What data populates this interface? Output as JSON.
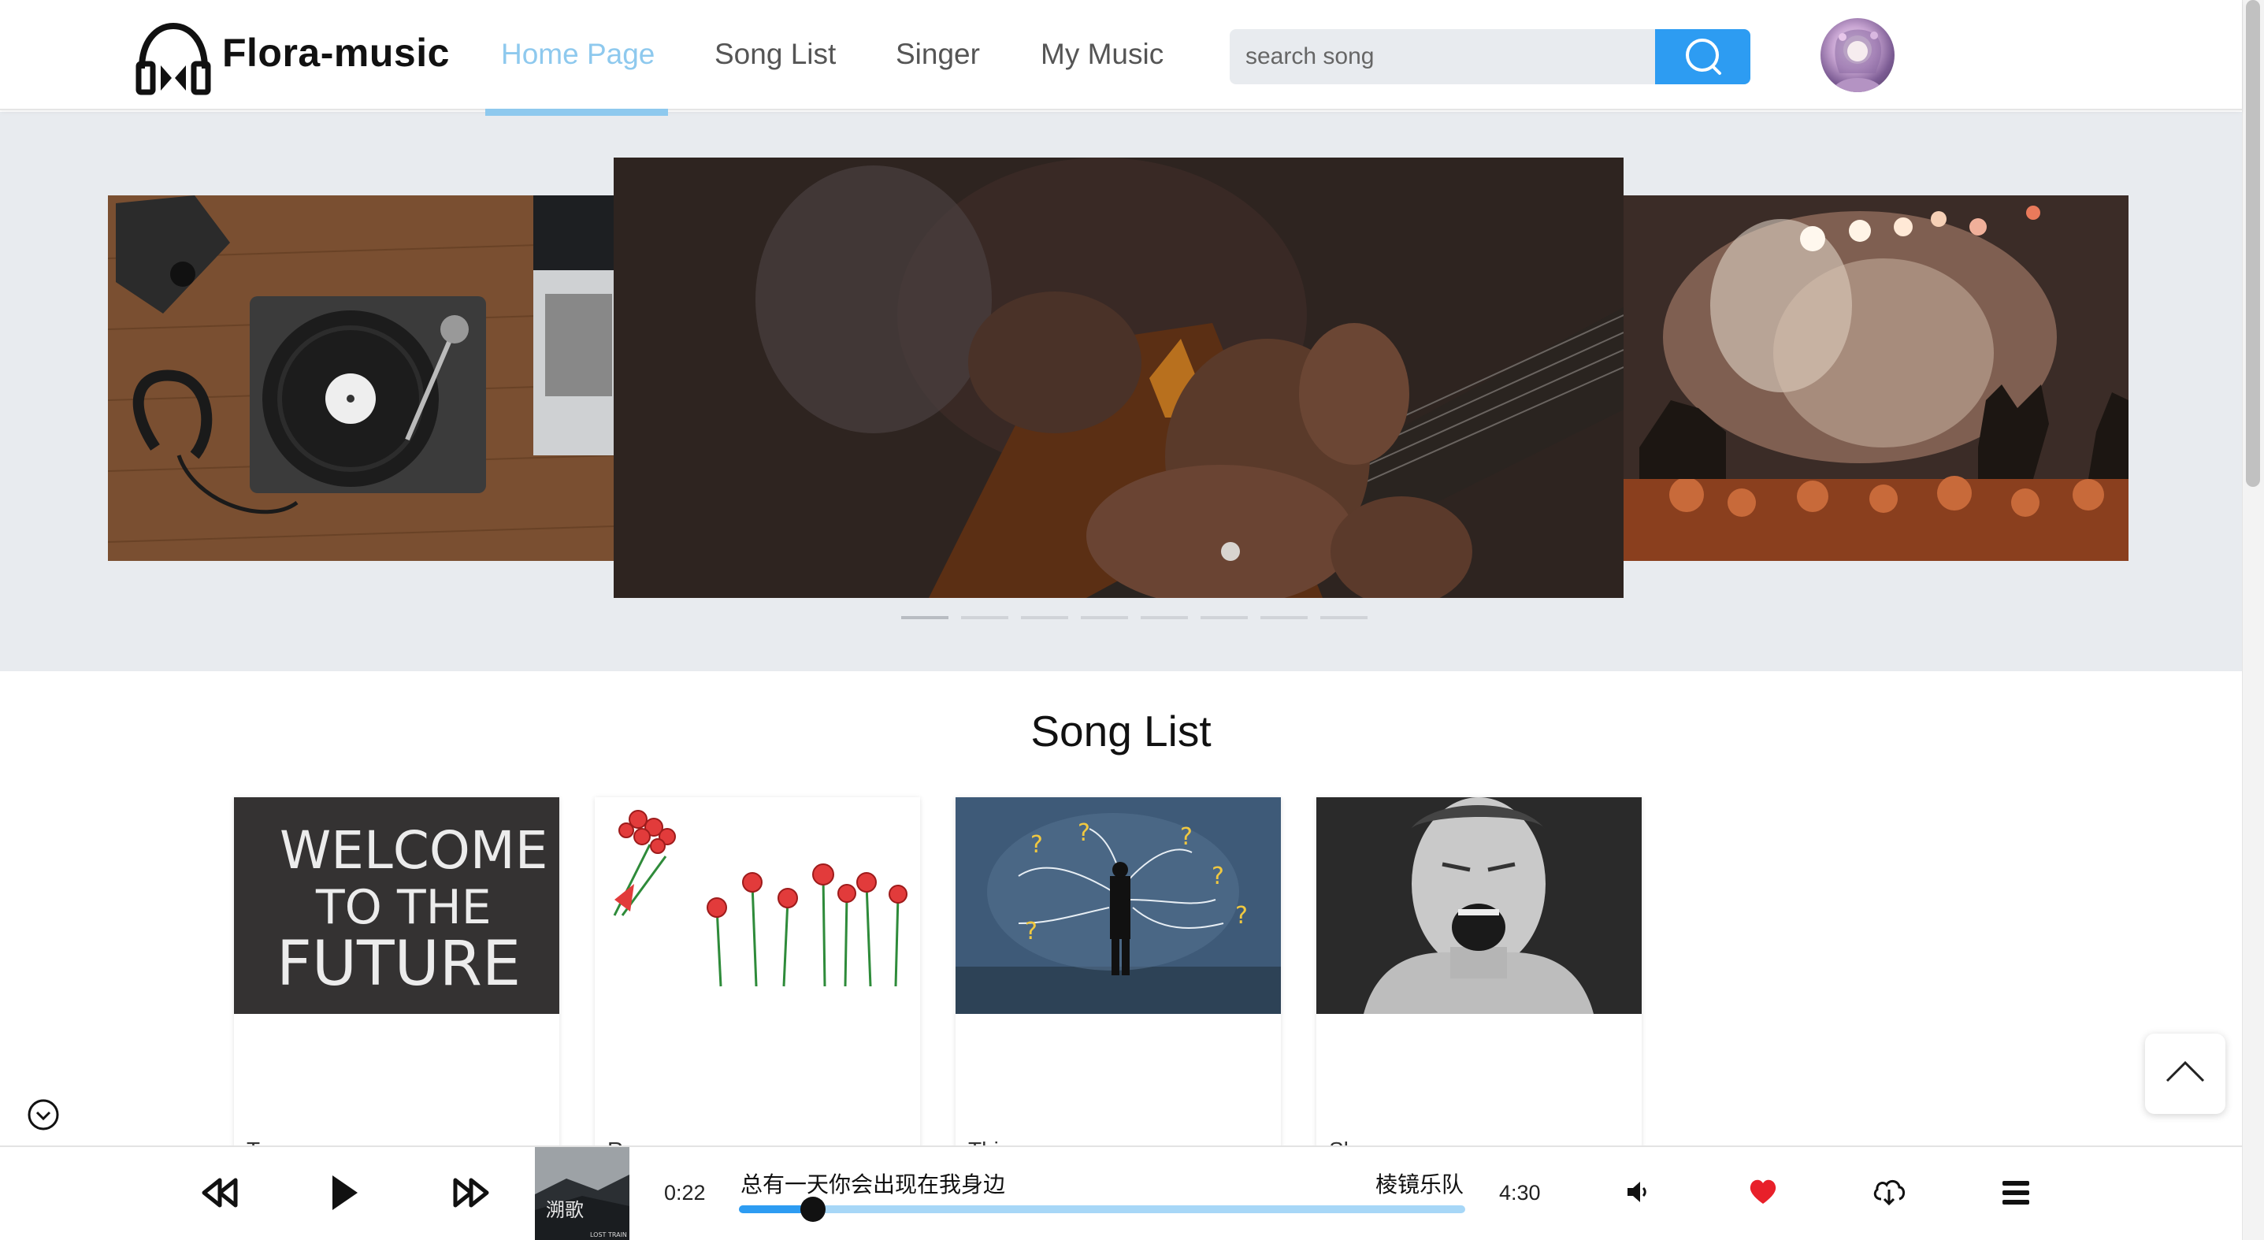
{
  "header": {
    "app_name": "Flora-music",
    "nav": [
      {
        "label": "Home Page",
        "active": true
      },
      {
        "label": "Song List",
        "active": false
      },
      {
        "label": "Singer",
        "active": false
      },
      {
        "label": "My Music",
        "active": false
      }
    ],
    "search": {
      "placeholder": "search song",
      "value": ""
    },
    "icons": {
      "logo": "headphones-icon",
      "search": "search-icon",
      "avatar": "user-avatar"
    }
  },
  "carousel": {
    "slide_count": 8,
    "active_index": 0,
    "slides": [
      "turntable-desk-image",
      "guitar-playing-image",
      "concert-crowd-image"
    ]
  },
  "song_list": {
    "title": "Song List",
    "cards": [
      {
        "image": "welcome-to-the-future-chalkboard",
        "image_text": "WELCOME TO THE FUTURE",
        "label": "T"
      },
      {
        "image": "red-roses-illustration",
        "label": "R"
      },
      {
        "image": "man-with-question-marks",
        "label": "Thi"
      },
      {
        "image": "screaming-woman-bw",
        "label": "Sh"
      }
    ]
  },
  "player": {
    "current_time": "0:22",
    "total_time": "4:30",
    "song_title": "总有一天你会出现在我身边",
    "singer": "棱镜乐队",
    "progress": 0.102,
    "album_text": "LOST TRAIN",
    "liked": true,
    "icons": [
      "rewind-icon",
      "play-icon",
      "fast-forward-icon",
      "volume-icon",
      "heart-icon",
      "cloud-download-icon",
      "playlist-icon"
    ]
  },
  "colors": {
    "accent": "#2d9cf2",
    "nav_active": "#8ec9ee",
    "carousel_bg": "#e8ebef",
    "like": "#e8202a"
  }
}
